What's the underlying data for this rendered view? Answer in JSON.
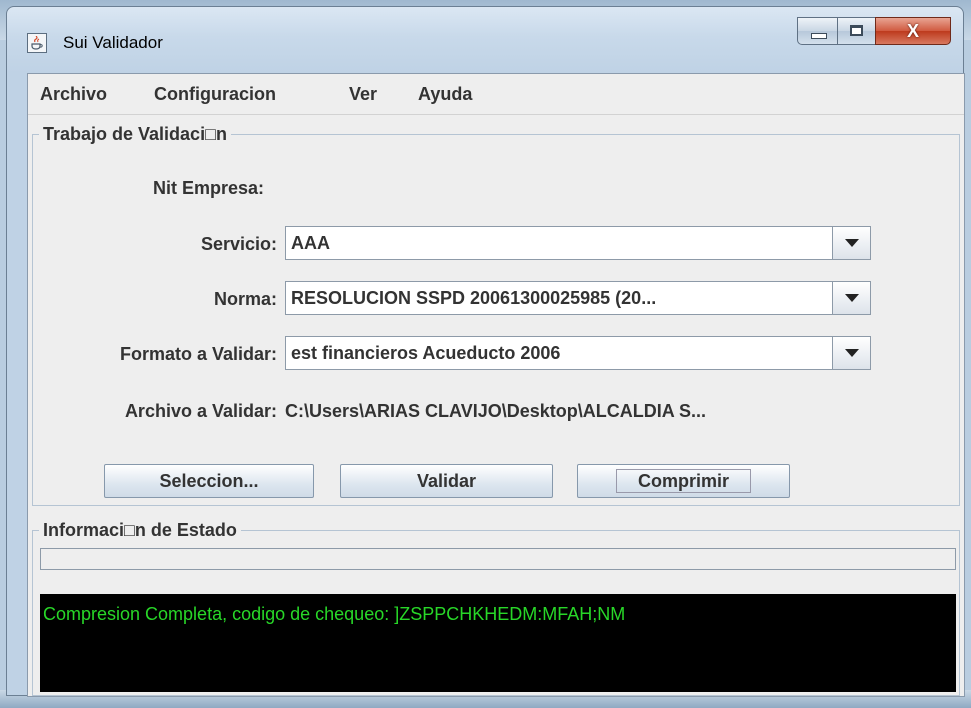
{
  "window": {
    "title": "Sui Validador",
    "close_symbol": "X"
  },
  "menu": [
    "Archivo",
    "Configuracion",
    "Ver",
    "Ayuda"
  ],
  "validation_panel": {
    "title": "Trabajo de Validaci□n",
    "nit_label": "Nit Empresa:",
    "nit_value": "",
    "servicio_label": "Servicio:",
    "servicio_value": "AAA",
    "norma_label": "Norma:",
    "norma_value": "RESOLUCION SSPD 20061300025985 (20...",
    "formato_label": "Formato a Validar:",
    "formato_value": "est financieros Acueducto 2006",
    "archivo_label": "Archivo a Validar:",
    "archivo_value": "C:\\Users\\ARIAS CLAVIJO\\Desktop\\ALCALDIA S..."
  },
  "buttons": {
    "seleccion": "Seleccion...",
    "validar": "Validar",
    "comprimir": "Comprimir"
  },
  "status_panel": {
    "title": "Informaci□n de Estado",
    "progress_percent": 0,
    "console_text": "Compresion Completa, codigo de chequeo: ]ZSPPCHKHEDM:MFAH;NM"
  },
  "colors": {
    "console_background": "#000000",
    "console_text": "#28d728",
    "close_button": "#c94a30"
  },
  "icons": {
    "app": "java-coffee-cup-icon",
    "minimize": "minimize-icon",
    "maximize": "maximize-icon",
    "close": "close-icon",
    "dropdown": "chevron-down-icon"
  }
}
